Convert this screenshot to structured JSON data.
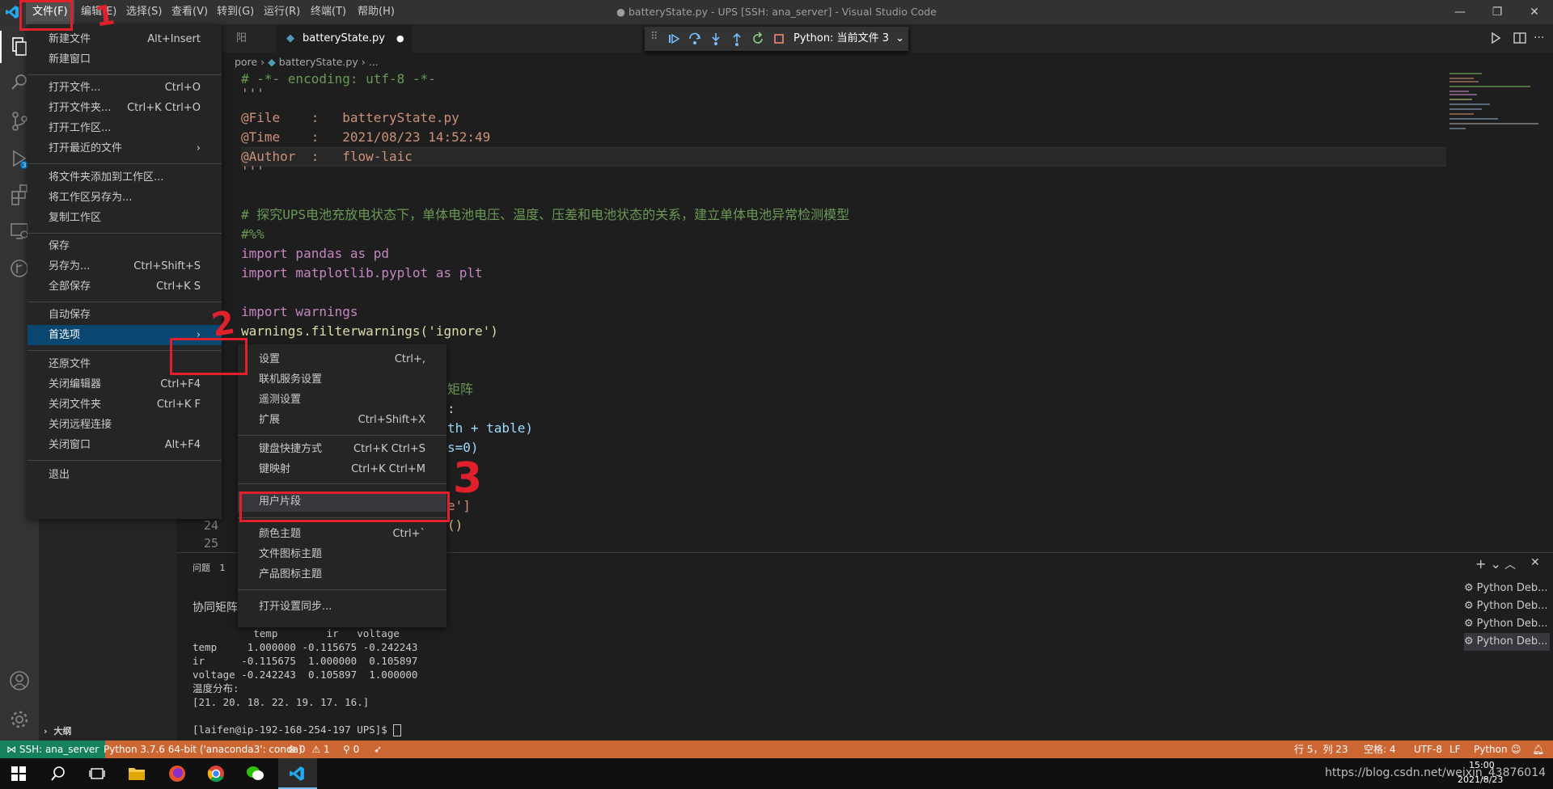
{
  "window": {
    "title": "● batteryState.py - UPS [SSH: ana_server] - Visual Studio Code",
    "menubar": [
      "文件(F)",
      "编辑(E)",
      "选择(S)",
      "查看(V)",
      "转到(G)",
      "运行(R)",
      "终端(T)",
      "帮助(H)"
    ]
  },
  "tabs": [
    {
      "label": "batteryState.py",
      "modified_dot": "●"
    }
  ],
  "tab_left_fragment": "阳",
  "breadcrumb": [
    "pore",
    "batteryState.py",
    "..."
  ],
  "debug_toolbar": {
    "config": "Python: 当前文件 3"
  },
  "code": {
    "lines": [
      {
        "num": "",
        "text": "# -*- encoding: utf-8 -*-"
      },
      {
        "num": "",
        "text": "'''"
      },
      {
        "num": "",
        "text": "@File    :   batteryState.py"
      },
      {
        "num": "",
        "text": "@Time    :   2021/08/23 14:52:49"
      },
      {
        "num": "",
        "text": "@Author  :   flow-laic"
      },
      {
        "num": "",
        "text": "'''"
      },
      {
        "num": "",
        "text": ""
      },
      {
        "num": "",
        "text": "# 探究UPS电池充放电状态下，单体电池电压、温度、压差和电池状态的关系，建立单体电池异常检测模型"
      },
      {
        "num": "",
        "text": "#%%"
      },
      {
        "num": "",
        "text": "import pandas as pd"
      },
      {
        "num": "",
        "text": "import matplotlib.pyplot as plt"
      },
      {
        "num": "",
        "text": ""
      },
      {
        "num": "",
        "text": "import warnings"
      },
      {
        "num": "",
        "text": "warnings.filterwarnings('ignore')"
      }
    ],
    "fragments": [
      "矩阵",
      ":",
      "th + table)",
      "s=0)",
      "e']",
      "()"
    ],
    "visible_line_numbers": [
      "24",
      "25"
    ]
  },
  "file_menu": {
    "groups": [
      [
        {
          "label": "新建文件",
          "key": "Alt+Insert"
        },
        {
          "label": "新建窗口",
          "key": ""
        }
      ],
      [
        {
          "label": "打开文件...",
          "key": "Ctrl+O"
        },
        {
          "label": "打开文件夹...",
          "key": "Ctrl+K Ctrl+O"
        },
        {
          "label": "打开工作区...",
          "key": ""
        },
        {
          "label": "打开最近的文件",
          "key": "›"
        }
      ],
      [
        {
          "label": "将文件夹添加到工作区...",
          "key": ""
        },
        {
          "label": "将工作区另存为...",
          "key": ""
        },
        {
          "label": "复制工作区",
          "key": ""
        }
      ],
      [
        {
          "label": "保存",
          "key": ""
        },
        {
          "label": "另存为...",
          "key": "Ctrl+Shift+S"
        },
        {
          "label": "全部保存",
          "key": "Ctrl+K S"
        }
      ],
      [
        {
          "label": "自动保存",
          "key": ""
        },
        {
          "label": "首选项",
          "key": "›"
        }
      ],
      [
        {
          "label": "还原文件",
          "key": ""
        },
        {
          "label": "关闭编辑器",
          "key": "Ctrl+F4"
        },
        {
          "label": "关闭文件夹",
          "key": "Ctrl+K F"
        },
        {
          "label": "关闭远程连接",
          "key": ""
        },
        {
          "label": "关闭窗口",
          "key": "Alt+F4"
        }
      ],
      [
        {
          "label": "退出",
          "key": ""
        }
      ]
    ]
  },
  "prefs_menu": {
    "groups": [
      [
        {
          "label": "设置",
          "key": "Ctrl+,"
        },
        {
          "label": "联机服务设置",
          "key": ""
        },
        {
          "label": "遥测设置",
          "key": ""
        },
        {
          "label": "扩展",
          "key": "Ctrl+Shift+X"
        }
      ],
      [
        {
          "label": "键盘快捷方式",
          "key": "Ctrl+K Ctrl+S"
        },
        {
          "label": "键映射",
          "key": "Ctrl+K Ctrl+M"
        }
      ],
      [
        {
          "label": "用户片段",
          "key": ""
        }
      ],
      [
        {
          "label": "颜色主题",
          "key": "Ctrl+`"
        },
        {
          "label": "文件图标主题",
          "key": ""
        },
        {
          "label": "产品图标主题",
          "key": ""
        }
      ],
      [
        {
          "label": "打开设置同步...",
          "key": ""
        }
      ]
    ]
  },
  "annotations": [
    "1",
    "2",
    "3"
  ],
  "panel": {
    "tab_problems": "问题",
    "problems_count": "1",
    "heading": "协同矩阵",
    "terminal_lines": [
      "          temp        ir   voltage",
      "temp     1.000000 -0.115675 -0.242243",
      "ir      -0.115675  1.000000  0.105897",
      "voltage -0.242243  0.105897  1.000000",
      "温度分布:",
      "[21. 20. 18. 22. 19. 17. 16.]",
      "",
      "[laifen@ip-192-168-254-197 UPS]$ "
    ],
    "terminals": [
      "Python Deb...",
      "Python Deb...",
      "Python Deb...",
      "Python Deb..."
    ]
  },
  "sidebar": {
    "outline": "大纲"
  },
  "statusbar": {
    "remote": "SSH: ana_server",
    "interpreter": "Python 3.7.6 64-bit ('anaconda3': conda)",
    "errors": "0",
    "warnings": "1",
    "ports": "0",
    "position": "行 5，列 23",
    "spaces": "空格: 4",
    "encoding": "UTF-8",
    "eol": "LF",
    "language": "Python"
  },
  "taskbar": {
    "time": "15:00",
    "date": "2021/8/23",
    "watermark": "https://blog.csdn.net/weixin_43876014"
  }
}
